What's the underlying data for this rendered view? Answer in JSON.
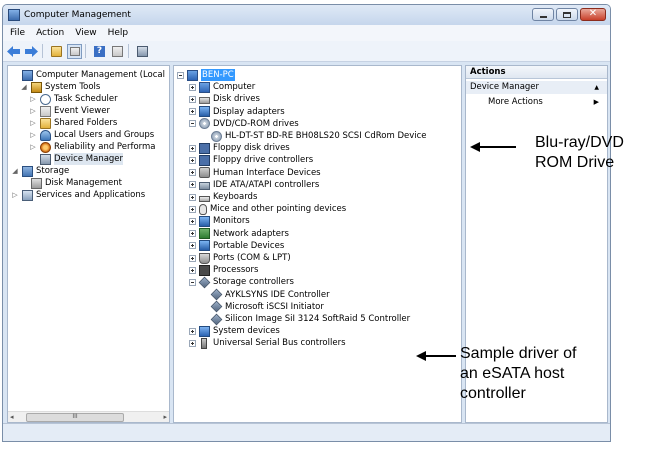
{
  "window": {
    "title": "Computer Management"
  },
  "menu": [
    "File",
    "Action",
    "View",
    "Help"
  ],
  "toolbar_icons": [
    "back-icon",
    "forward-icon",
    "up-folder-icon",
    "show-hide-tree-icon",
    "help-icon",
    "properties-icon",
    "scan-hardware-icon"
  ],
  "left_tree": [
    {
      "label": "Computer Management (Local",
      "icon": "computer-management-icon",
      "level": 0,
      "expander": ""
    },
    {
      "label": "System Tools",
      "icon": "system-tools-icon",
      "level": 1,
      "expander": "◢"
    },
    {
      "label": "Task Scheduler",
      "icon": "clock-icon",
      "level": 2,
      "expander": "▷"
    },
    {
      "label": "Event Viewer",
      "icon": "event-viewer-icon",
      "level": 2,
      "expander": "▷"
    },
    {
      "label": "Shared Folders",
      "icon": "shared-folder-icon",
      "level": 2,
      "expander": "▷"
    },
    {
      "label": "Local Users and Groups",
      "icon": "users-icon",
      "level": 2,
      "expander": "▷"
    },
    {
      "label": "Reliability and Performa",
      "icon": "performance-icon",
      "level": 2,
      "expander": "▷"
    },
    {
      "label": "Device Manager",
      "icon": "device-manager-icon",
      "level": 2,
      "expander": "",
      "selected": true
    },
    {
      "label": "Storage",
      "icon": "storage-icon",
      "level": 0,
      "expander": "◢"
    },
    {
      "label": "Disk Management",
      "icon": "disk-icon",
      "level": 1,
      "expander": ""
    },
    {
      "label": "Services and Applications",
      "icon": "services-icon",
      "level": 0,
      "expander": "▷"
    }
  ],
  "scrollbar": {
    "thumb_label": "III"
  },
  "device_tree": [
    {
      "label": "BEN-PC",
      "icon": "computer-icon",
      "level": 0,
      "box": "minus",
      "selected": true
    },
    {
      "label": "Computer",
      "icon": "pc-icon",
      "level": 1,
      "box": "plus"
    },
    {
      "label": "Disk drives",
      "icon": "drive-icon",
      "level": 1,
      "box": "plus"
    },
    {
      "label": "Display adapters",
      "icon": "monitor-icon",
      "level": 1,
      "box": "plus"
    },
    {
      "label": "DVD/CD-ROM drives",
      "icon": "cd-icon",
      "level": 1,
      "box": "minus"
    },
    {
      "label": "HL-DT-ST BD-RE  BH08LS20 SCSI CdRom Device",
      "icon": "cd-icon",
      "level": 2,
      "box": ""
    },
    {
      "label": "Floppy disk drives",
      "icon": "floppy-icon",
      "level": 1,
      "box": "plus"
    },
    {
      "label": "Floppy drive controllers",
      "icon": "floppy-icon",
      "level": 1,
      "box": "plus"
    },
    {
      "label": "Human Interface Devices",
      "icon": "hid-icon",
      "level": 1,
      "box": "plus"
    },
    {
      "label": "IDE ATA/ATAPI controllers",
      "icon": "ide-icon",
      "level": 1,
      "box": "plus"
    },
    {
      "label": "Keyboards",
      "icon": "keyboard-icon",
      "level": 1,
      "box": "plus"
    },
    {
      "label": "Mice and other pointing devices",
      "icon": "mouse-icon",
      "level": 1,
      "box": "plus"
    },
    {
      "label": "Monitors",
      "icon": "monitor-icon",
      "level": 1,
      "box": "plus"
    },
    {
      "label": "Network adapters",
      "icon": "network-icon",
      "level": 1,
      "box": "plus"
    },
    {
      "label": "Portable Devices",
      "icon": "portable-device-icon",
      "level": 1,
      "box": "plus"
    },
    {
      "label": "Ports (COM & LPT)",
      "icon": "port-icon",
      "level": 1,
      "box": "plus"
    },
    {
      "label": "Processors",
      "icon": "processor-icon",
      "level": 1,
      "box": "plus"
    },
    {
      "label": "Storage controllers",
      "icon": "storage-controller-icon",
      "level": 1,
      "box": "minus"
    },
    {
      "label": "AYKLSYNS IDE Controller",
      "icon": "storage-controller-icon",
      "level": 2,
      "box": ""
    },
    {
      "label": "Microsoft iSCSI Initiator",
      "icon": "storage-controller-icon",
      "level": 2,
      "box": ""
    },
    {
      "label": "Silicon Image SiI 3124 SoftRaid 5 Controller",
      "icon": "storage-controller-icon",
      "level": 2,
      "box": ""
    },
    {
      "label": "System devices",
      "icon": "system-devices-icon",
      "level": 1,
      "box": "plus"
    },
    {
      "label": "Universal Serial Bus controllers",
      "icon": "usb-icon",
      "level": 1,
      "box": "plus"
    }
  ],
  "actions": {
    "header": "Actions",
    "section": "Device Manager",
    "more": "More Actions"
  },
  "annotations": {
    "bluray_line1": "Blu-ray/DVD",
    "bluray_line2": "ROM Drive",
    "esata_line1": "Sample driver of",
    "esata_line2": "an eSATA host",
    "esata_line3": "controller"
  }
}
